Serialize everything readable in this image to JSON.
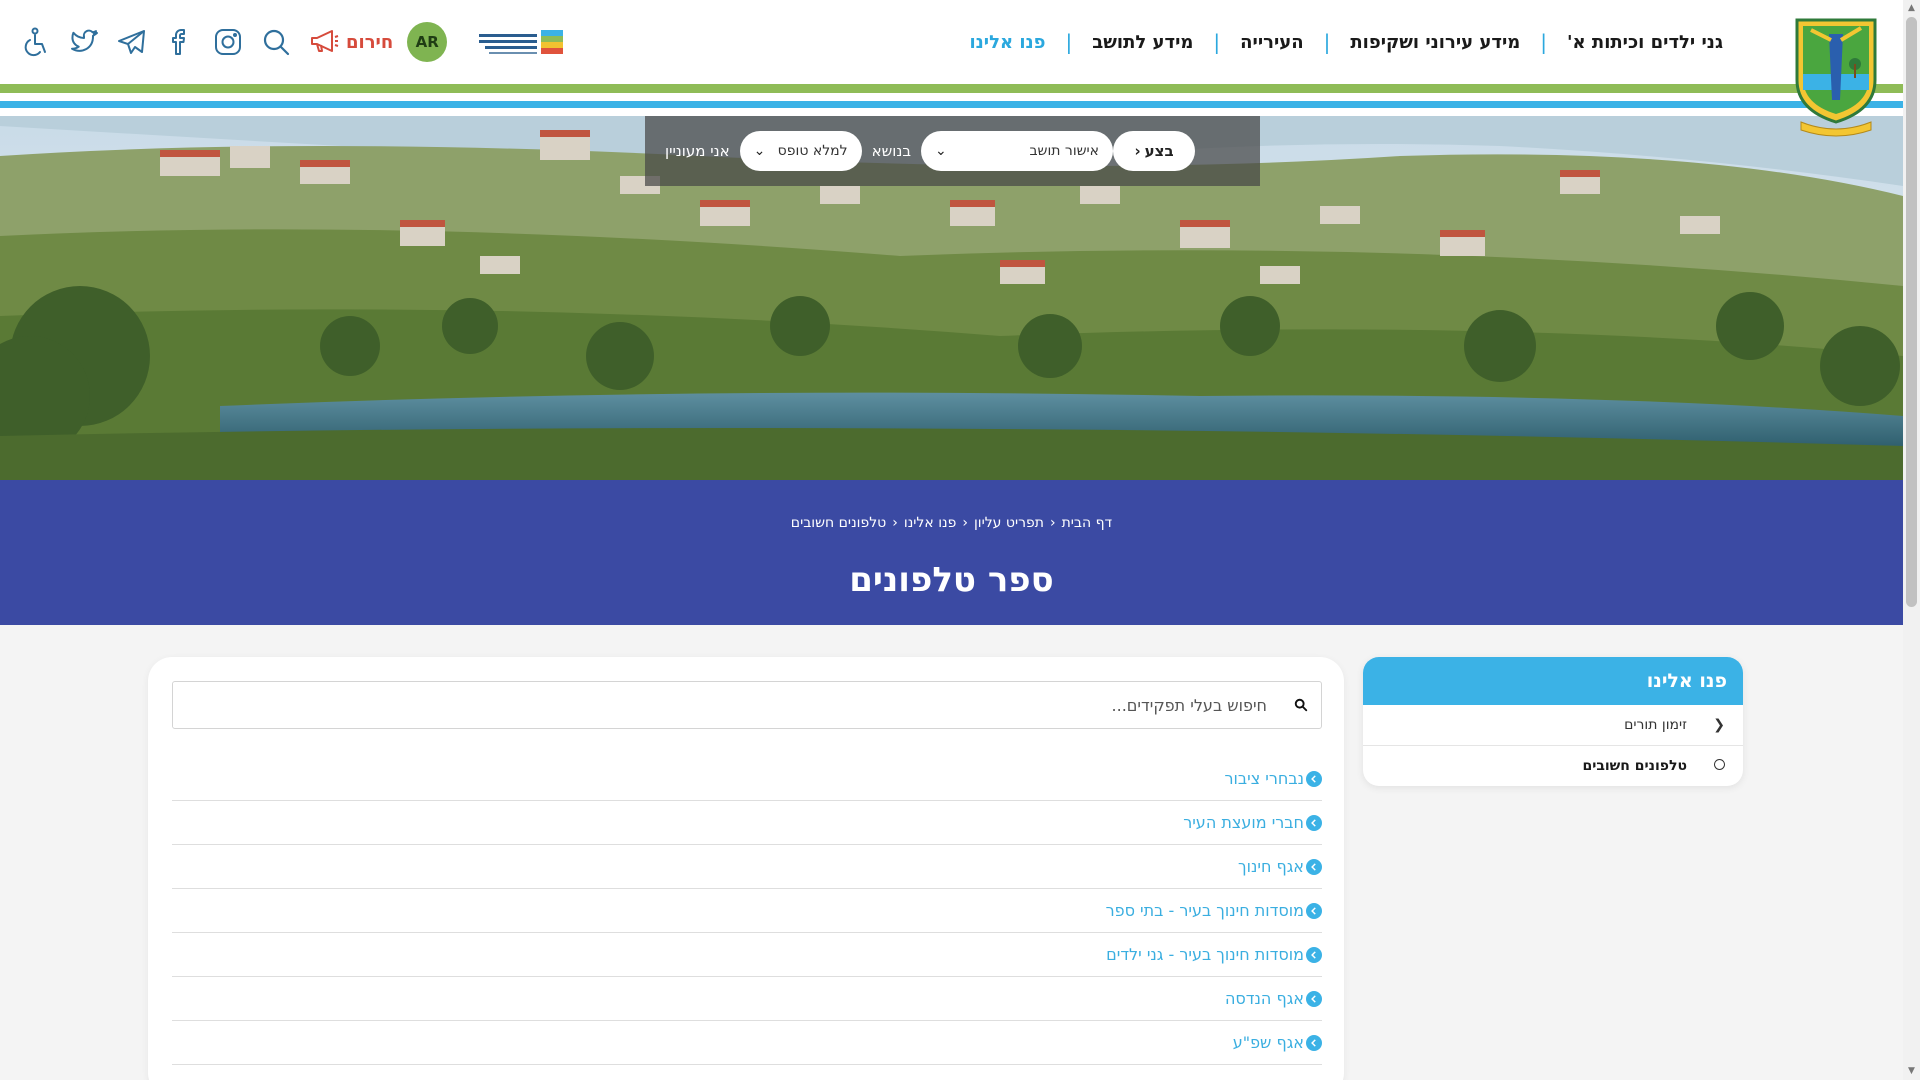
{
  "header": {
    "nav": [
      {
        "label": "גני ילדים וכיתות א'",
        "active": false
      },
      {
        "label": "מידע עירוני ושקיפות",
        "active": false
      },
      {
        "label": "העירייה",
        "active": false
      },
      {
        "label": "מידע לתושב",
        "active": false
      },
      {
        "label": "פנו אלינו",
        "active": true
      }
    ],
    "emergency_label": "חירום",
    "language_button": "AR",
    "icons": [
      "accessibility-icon",
      "twitter-icon",
      "telegram-icon",
      "facebook-icon",
      "instagram-icon",
      "search-icon",
      "megaphone-icon"
    ],
    "colors": {
      "accent_blue": "#2ba8de",
      "stripe_green": "#8fbc57",
      "stripe_blue": "#3bb2e6",
      "emergency_red": "#d64b3c",
      "band_blue": "#3b4aa3"
    }
  },
  "filter": {
    "label_interested": "אני מעוניין",
    "select_action": "למלא טופס",
    "label_topic": "בנושא",
    "select_topic": "אישור תושב",
    "go_label": "בצע"
  },
  "breadcrumb": [
    "דף הבית",
    "תפריט עליון",
    "פנו אלינו",
    "טלפונים חשובים"
  ],
  "page_title": "ספר טלפונים",
  "sidebar": {
    "title": "פנו אלינו",
    "items": [
      {
        "label": "זימון תורים",
        "active": false
      },
      {
        "label": "טלפונים חשובים",
        "active": true
      }
    ]
  },
  "search": {
    "placeholder": "חיפוש בעלי תפקידים..."
  },
  "directory": [
    "נבחרי ציבור",
    "חברי מועצת העיר",
    "אגף חינוך",
    "מוסדות חינוך בעיר - בתי ספר",
    "מוסדות חינוך בעיר - גני ילדים",
    "אגף הנדסה",
    "אגף שפ\"ע"
  ]
}
